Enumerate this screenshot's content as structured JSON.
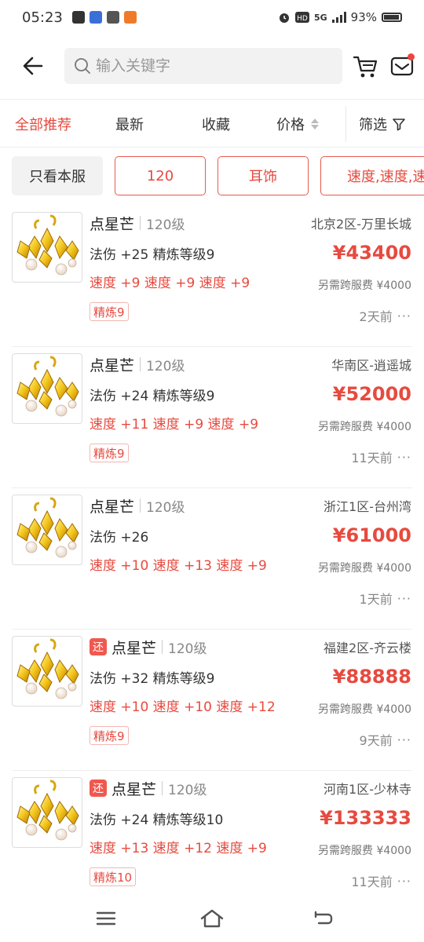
{
  "status_bar": {
    "time": "05:23",
    "network": "5G",
    "battery": "93%"
  },
  "search": {
    "placeholder": "输入关键字"
  },
  "sort_tabs": [
    {
      "label": "全部推荐",
      "active": true
    },
    {
      "label": "最新",
      "active": false
    },
    {
      "label": "收藏",
      "active": false
    },
    {
      "label": "价格",
      "active": false
    },
    {
      "label": "筛选",
      "active": false
    }
  ],
  "filter_chips": [
    {
      "label": "只看本服"
    },
    {
      "label": "120"
    },
    {
      "label": "耳饰"
    },
    {
      "label": "速度,速度,速度"
    }
  ],
  "items": [
    {
      "name": "点星芒",
      "returned": false,
      "level": "120级",
      "server": "北京2区-万里长城",
      "attrs": "法伤 +25 精炼等级9",
      "speeds": "速度 +9 速度 +9 速度 +9",
      "refine": "精炼9",
      "price": "¥43400",
      "fee": "另需跨服费 ¥4000",
      "time": "2天前"
    },
    {
      "name": "点星芒",
      "returned": false,
      "level": "120级",
      "server": "华南区-逍遥城",
      "attrs": "法伤 +24 精炼等级9",
      "speeds": "速度 +11 速度 +9 速度 +9",
      "refine": "精炼9",
      "price": "¥52000",
      "fee": "另需跨服费 ¥4000",
      "time": "11天前"
    },
    {
      "name": "点星芒",
      "returned": false,
      "level": "120级",
      "server": "浙江1区-台州湾",
      "attrs": "法伤 +26",
      "speeds": "速度 +10 速度 +13 速度 +9",
      "refine": "",
      "price": "¥61000",
      "fee": "另需跨服费 ¥4000",
      "time": "1天前"
    },
    {
      "name": "点星芒",
      "returned": true,
      "returned_label": "还",
      "level": "120级",
      "server": "福建2区-齐云楼",
      "attrs": "法伤 +32 精炼等级9",
      "speeds": "速度 +10 速度 +10 速度 +12",
      "refine": "精炼9",
      "price": "¥88888",
      "fee": "另需跨服费 ¥4000",
      "time": "9天前"
    },
    {
      "name": "点星芒",
      "returned": true,
      "returned_label": "还",
      "level": "120级",
      "server": "河南1区-少林寺",
      "attrs": "法伤 +24 精炼等级10",
      "speeds": "速度 +13 速度 +12 速度 +9",
      "refine": "精炼10",
      "price": "¥133333",
      "fee": "另需跨服费 ¥4000",
      "time": "11天前"
    }
  ],
  "more_label": "···",
  "colors": {
    "accent": "#e74a3f",
    "chip_border": "#e85a50",
    "returned_tag": "#f0584f"
  }
}
